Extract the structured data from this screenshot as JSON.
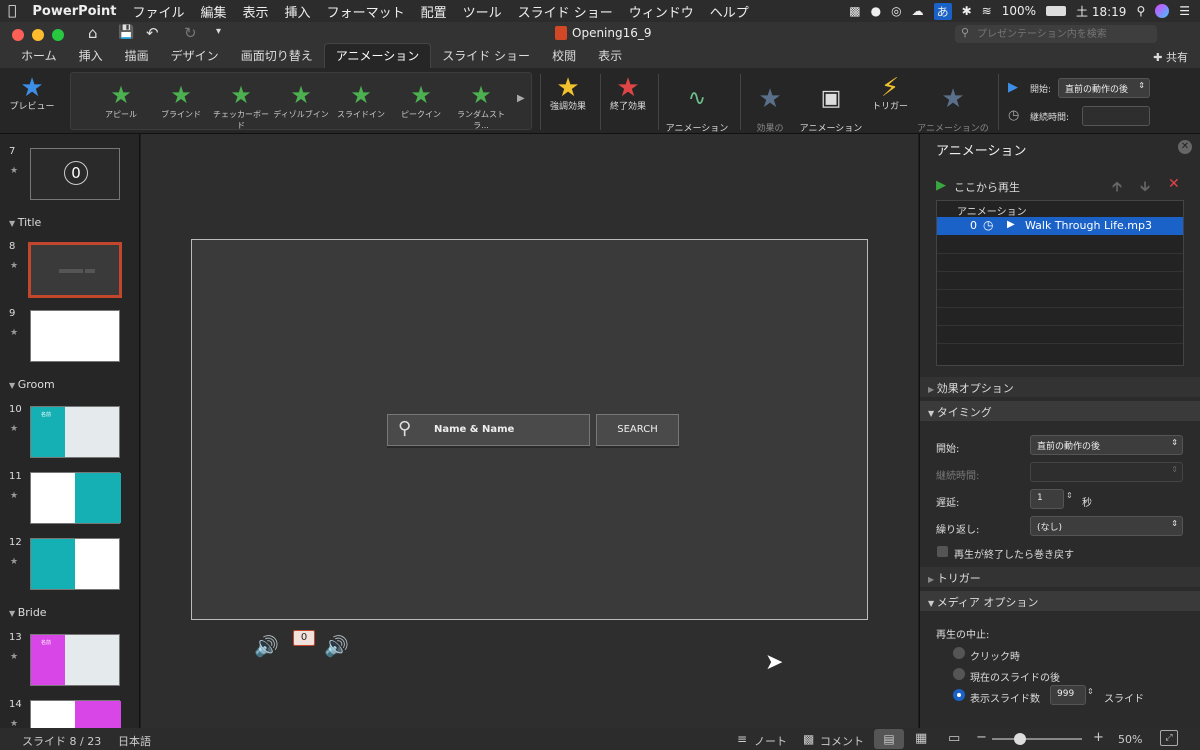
{
  "menubar": {
    "app": "PowerPoint",
    "items": [
      "ファイル",
      "編集",
      "表示",
      "挿入",
      "フォーマット",
      "配置",
      "ツール",
      "スライド ショー",
      "ウィンドウ",
      "ヘルプ"
    ],
    "battery": "100%",
    "clock": "土 18:19",
    "ime": "あ"
  },
  "titlebar": {
    "title": "Opening16_9",
    "search_placeholder": "プレゼンテーション内を検索"
  },
  "tabs": [
    "ホーム",
    "挿入",
    "描画",
    "デザイン",
    "画面切り替え",
    "アニメーション",
    "スライド ショー",
    "校閲",
    "表示"
  ],
  "active_tab": "アニメーション",
  "share_label": "共有",
  "ribbon": {
    "preview": "プレビュー",
    "gallery": [
      "アピール",
      "ブラインド",
      "チェッカーボード",
      "ディゾルブイン",
      "スライドイン",
      "ピークイン",
      "ランダムストラ..."
    ],
    "emphasis": "強調効果",
    "exit": "終了効果",
    "path": "アニメーション\nの軌跡",
    "effect_options": "効果の\nオプション",
    "anim_window": "アニメーション\nウィンドウ",
    "trigger": "トリガー",
    "copy": "アニメーションの\nコピー/貼り付け",
    "start_label": "開始:",
    "start_value": "直前の動作の後",
    "duration_label": "継続時間:"
  },
  "thumbnails": {
    "items": [
      {
        "num": "7"
      },
      {
        "num": "8"
      },
      {
        "num": "9"
      },
      {
        "num": "10"
      },
      {
        "num": "11"
      },
      {
        "num": "12"
      },
      {
        "num": "13"
      },
      {
        "num": "14"
      }
    ],
    "sections": [
      "Title",
      "Groom",
      "Bride"
    ],
    "slide7_text": "0",
    "slide10_text": "名前",
    "slide13_text": "名前"
  },
  "slide": {
    "search_text": "Name & Name",
    "search_button": "SEARCH",
    "counter": "0"
  },
  "pane": {
    "title": "アニメーション",
    "play_from": "ここから再生",
    "list_header": "アニメーション",
    "list_item_index": "0",
    "list_item_name": "Walk Through Life.mp3",
    "effect_options": "効果オプション",
    "timing": "タイミング",
    "start_label": "開始:",
    "start_value": "直前の動作の後",
    "duration_label": "継続時間:",
    "delay_label": "遅延:",
    "delay_value": "1",
    "delay_unit": "秒",
    "repeat_label": "繰り返し:",
    "repeat_value": "(なし)",
    "rewind_label": "再生が終了したら巻き戻す",
    "trigger": "トリガー",
    "media_options": "メディア オプション",
    "stop_label": "再生の中止:",
    "opt_click": "クリック時",
    "opt_after_current": "現在のスライドの後",
    "opt_after_slides": "表示スライド数",
    "slides_value": "999",
    "slides_unit": "スライド"
  },
  "status": {
    "slide_pos": "スライド 8 / 23",
    "language": "日本語",
    "notes": "ノート",
    "comments": "コメント",
    "zoom": "50%"
  },
  "colors": {
    "accent_blue": "#1a62c8",
    "selected_thumb_border": "#c2462b",
    "green_star": "#4caf50"
  }
}
